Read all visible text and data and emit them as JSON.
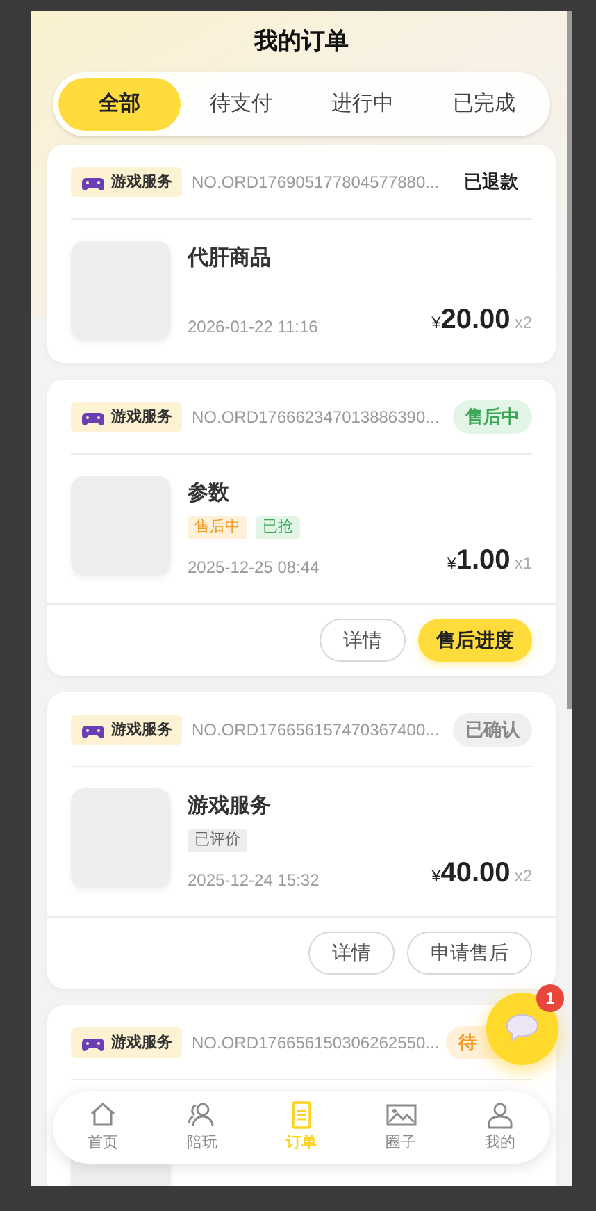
{
  "header": {
    "title": "我的订单"
  },
  "tabs": [
    {
      "label": "全部",
      "selected": true
    },
    {
      "label": "待支付",
      "selected": false
    },
    {
      "label": "进行中",
      "selected": false
    },
    {
      "label": "已完成",
      "selected": false
    }
  ],
  "orders": [
    {
      "category": "游戏服务",
      "order_no": "NO.ORD176905177804577880...",
      "status": "已退款",
      "kind": "plain",
      "product": "代肝商品",
      "date": "2026-01-22 11:16",
      "currency": "¥",
      "price": "20.00",
      "quantity": "x2"
    },
    {
      "category": "游戏服务",
      "order_no": "NO.ORD176662347013886390...",
      "status": "售后中",
      "kind": "green",
      "product": "参数",
      "tags": [
        {
          "label": "售后中",
          "kind": "orange"
        },
        {
          "label": "已抢",
          "kind": "green"
        }
      ],
      "date": "2025-12-25 08:44",
      "currency": "¥",
      "price": "1.00",
      "quantity": "x1",
      "actions": [
        {
          "label": "详情",
          "primary": false
        },
        {
          "label": "售后进度",
          "primary": true
        }
      ]
    },
    {
      "category": "游戏服务",
      "order_no": "NO.ORD176656157470367400...",
      "status": "已确认",
      "kind": "grey",
      "product": "游戏服务",
      "tags": [
        {
          "label": "已评价",
          "kind": "grey"
        }
      ],
      "date": "2025-12-24 15:32",
      "currency": "¥",
      "price": "40.00",
      "quantity": "x2",
      "actions": [
        {
          "label": "详情",
          "primary": false
        },
        {
          "label": "申请售后",
          "primary": false
        }
      ]
    },
    {
      "category": "游戏服务",
      "order_no": "NO.ORD176656150306262550...",
      "status": "待",
      "kind": "orange"
    }
  ],
  "bottom_nav": [
    {
      "label": "首页",
      "selected": false
    },
    {
      "label": "陪玩",
      "selected": false
    },
    {
      "label": "订单",
      "selected": true
    },
    {
      "label": "圈子",
      "selected": false
    },
    {
      "label": "我的",
      "selected": false
    }
  ],
  "chat_button": {
    "badge": "1"
  }
}
